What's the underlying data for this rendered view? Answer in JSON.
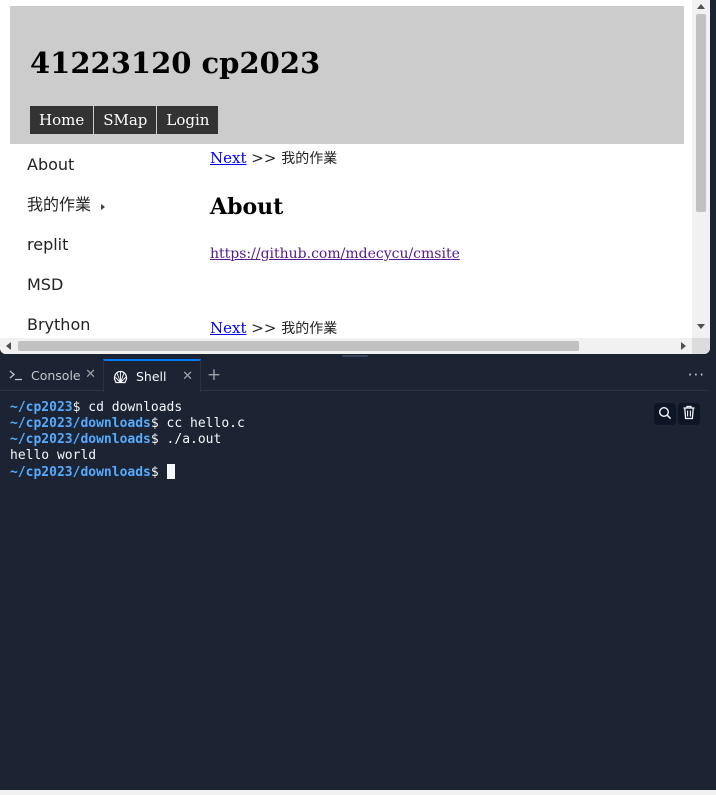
{
  "preview": {
    "site_title": "41223120 cp2023",
    "nav": [
      "Home",
      "SMap",
      "Login"
    ],
    "sidebar": [
      {
        "label": "About"
      },
      {
        "label": "我的作業",
        "has_submenu": true
      },
      {
        "label": "replit"
      },
      {
        "label": "MSD"
      },
      {
        "label": "Brython"
      }
    ],
    "breadcrumb": {
      "link": "Next",
      "separator": ">>",
      "current": "我的作業"
    },
    "page_heading": "About",
    "repo_link": "https://github.com/mdecycu/cmsite"
  },
  "panel": {
    "tabs": [
      {
        "label": "Console",
        "icon": "terminal-prompt-icon",
        "active": false
      },
      {
        "label": "Shell",
        "icon": "shell-icon",
        "active": true
      }
    ],
    "add_tab_label": "+",
    "more_label": "···",
    "accent_color": "#0079f2",
    "terminal": {
      "lines": [
        {
          "path": "~/cp2023",
          "prompt": "$ ",
          "cmd": "cd downloads"
        },
        {
          "path": "~/cp2023/downloads",
          "prompt": "$ ",
          "cmd": "cc hello.c"
        },
        {
          "path": "~/cp2023/downloads",
          "prompt": "$ ",
          "cmd": "./a.out"
        },
        {
          "output": "hello world"
        },
        {
          "path": "~/cp2023/downloads",
          "prompt": "$ ",
          "cmd": "",
          "cursor": true
        }
      ]
    }
  }
}
